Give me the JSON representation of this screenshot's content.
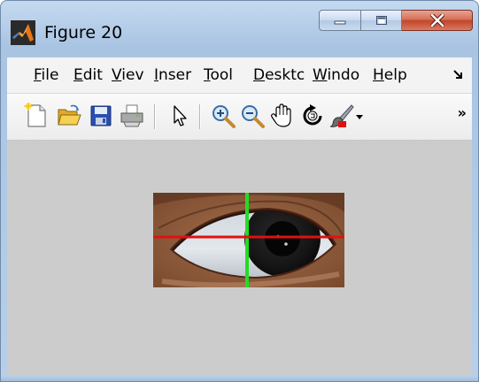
{
  "window": {
    "title": "Figure 20",
    "caption_buttons": [
      "minimize",
      "maximize",
      "close"
    ]
  },
  "menubar": {
    "items": [
      {
        "accel": "F",
        "rest": "ile"
      },
      {
        "accel": "E",
        "rest": "dit"
      },
      {
        "accel": "V",
        "rest": "iev"
      },
      {
        "accel": "I",
        "rest": "nser"
      },
      {
        "accel": "T",
        "rest": "ool"
      },
      {
        "accel": "D",
        "rest": "esktc"
      },
      {
        "accel": "W",
        "rest": "indo"
      },
      {
        "accel": "H",
        "rest": "elp"
      }
    ]
  },
  "toolbar": {
    "tools": [
      "new-figure-icon",
      "open-file-icon",
      "save-icon",
      "print-icon",
      "edit-plot-arrow-icon",
      "zoom-in-icon",
      "zoom-out-icon",
      "pan-hand-icon",
      "rotate-3d-icon",
      "brush-icon",
      "brush-dropdown-icon"
    ],
    "overflow": "»"
  },
  "colors": {
    "figure_background": "#cccccc",
    "vertical_line": "#22dd22",
    "horizontal_line": "#e01010"
  }
}
